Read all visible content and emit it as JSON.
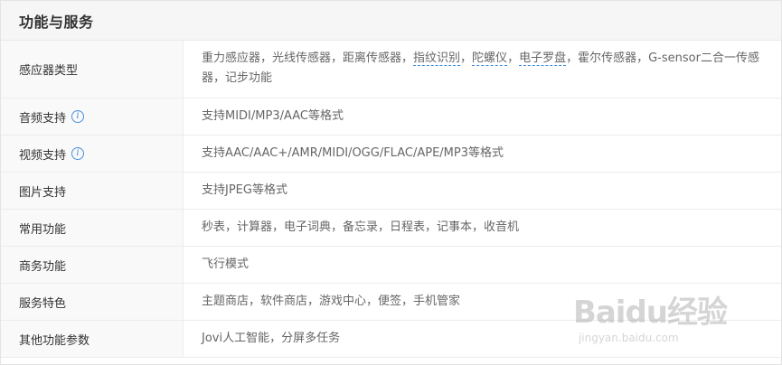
{
  "section": {
    "title": "功能与服务"
  },
  "rows": [
    {
      "key": "感应器类型",
      "value_parts": [
        "重力感应器，光线传感器，距离传感器，",
        "指纹识别",
        "，",
        "陀螺仪",
        "，",
        "电子罗盘",
        "，霍尔传感器，G-sensor二合一传感器，记步功能"
      ]
    },
    {
      "key": "音频支持",
      "value": "支持MIDI/MP3/AAC等格式"
    },
    {
      "key": "视频支持",
      "value": "支持AAC/AAC+/AMR/MIDI/OGG/FLAC/APE/MP3等格式"
    },
    {
      "key": "图片支持",
      "value": "支持JPEG等格式"
    },
    {
      "key": "常用功能",
      "value": "秒表，计算器，电子词典，备忘录，日程表，记事本，收音机"
    },
    {
      "key": "商务功能",
      "value": "飞行模式"
    },
    {
      "key": "服务特色",
      "value": "主题商店，软件商店，游戏中心，便签，手机管家"
    },
    {
      "key": "其他功能参数",
      "value": "Jovi人工智能，分屏多任务"
    }
  ],
  "icons": {
    "info": "i"
  },
  "watermark": {
    "logo": "Baidu经验",
    "sub": "jingyan.baidu.com"
  }
}
